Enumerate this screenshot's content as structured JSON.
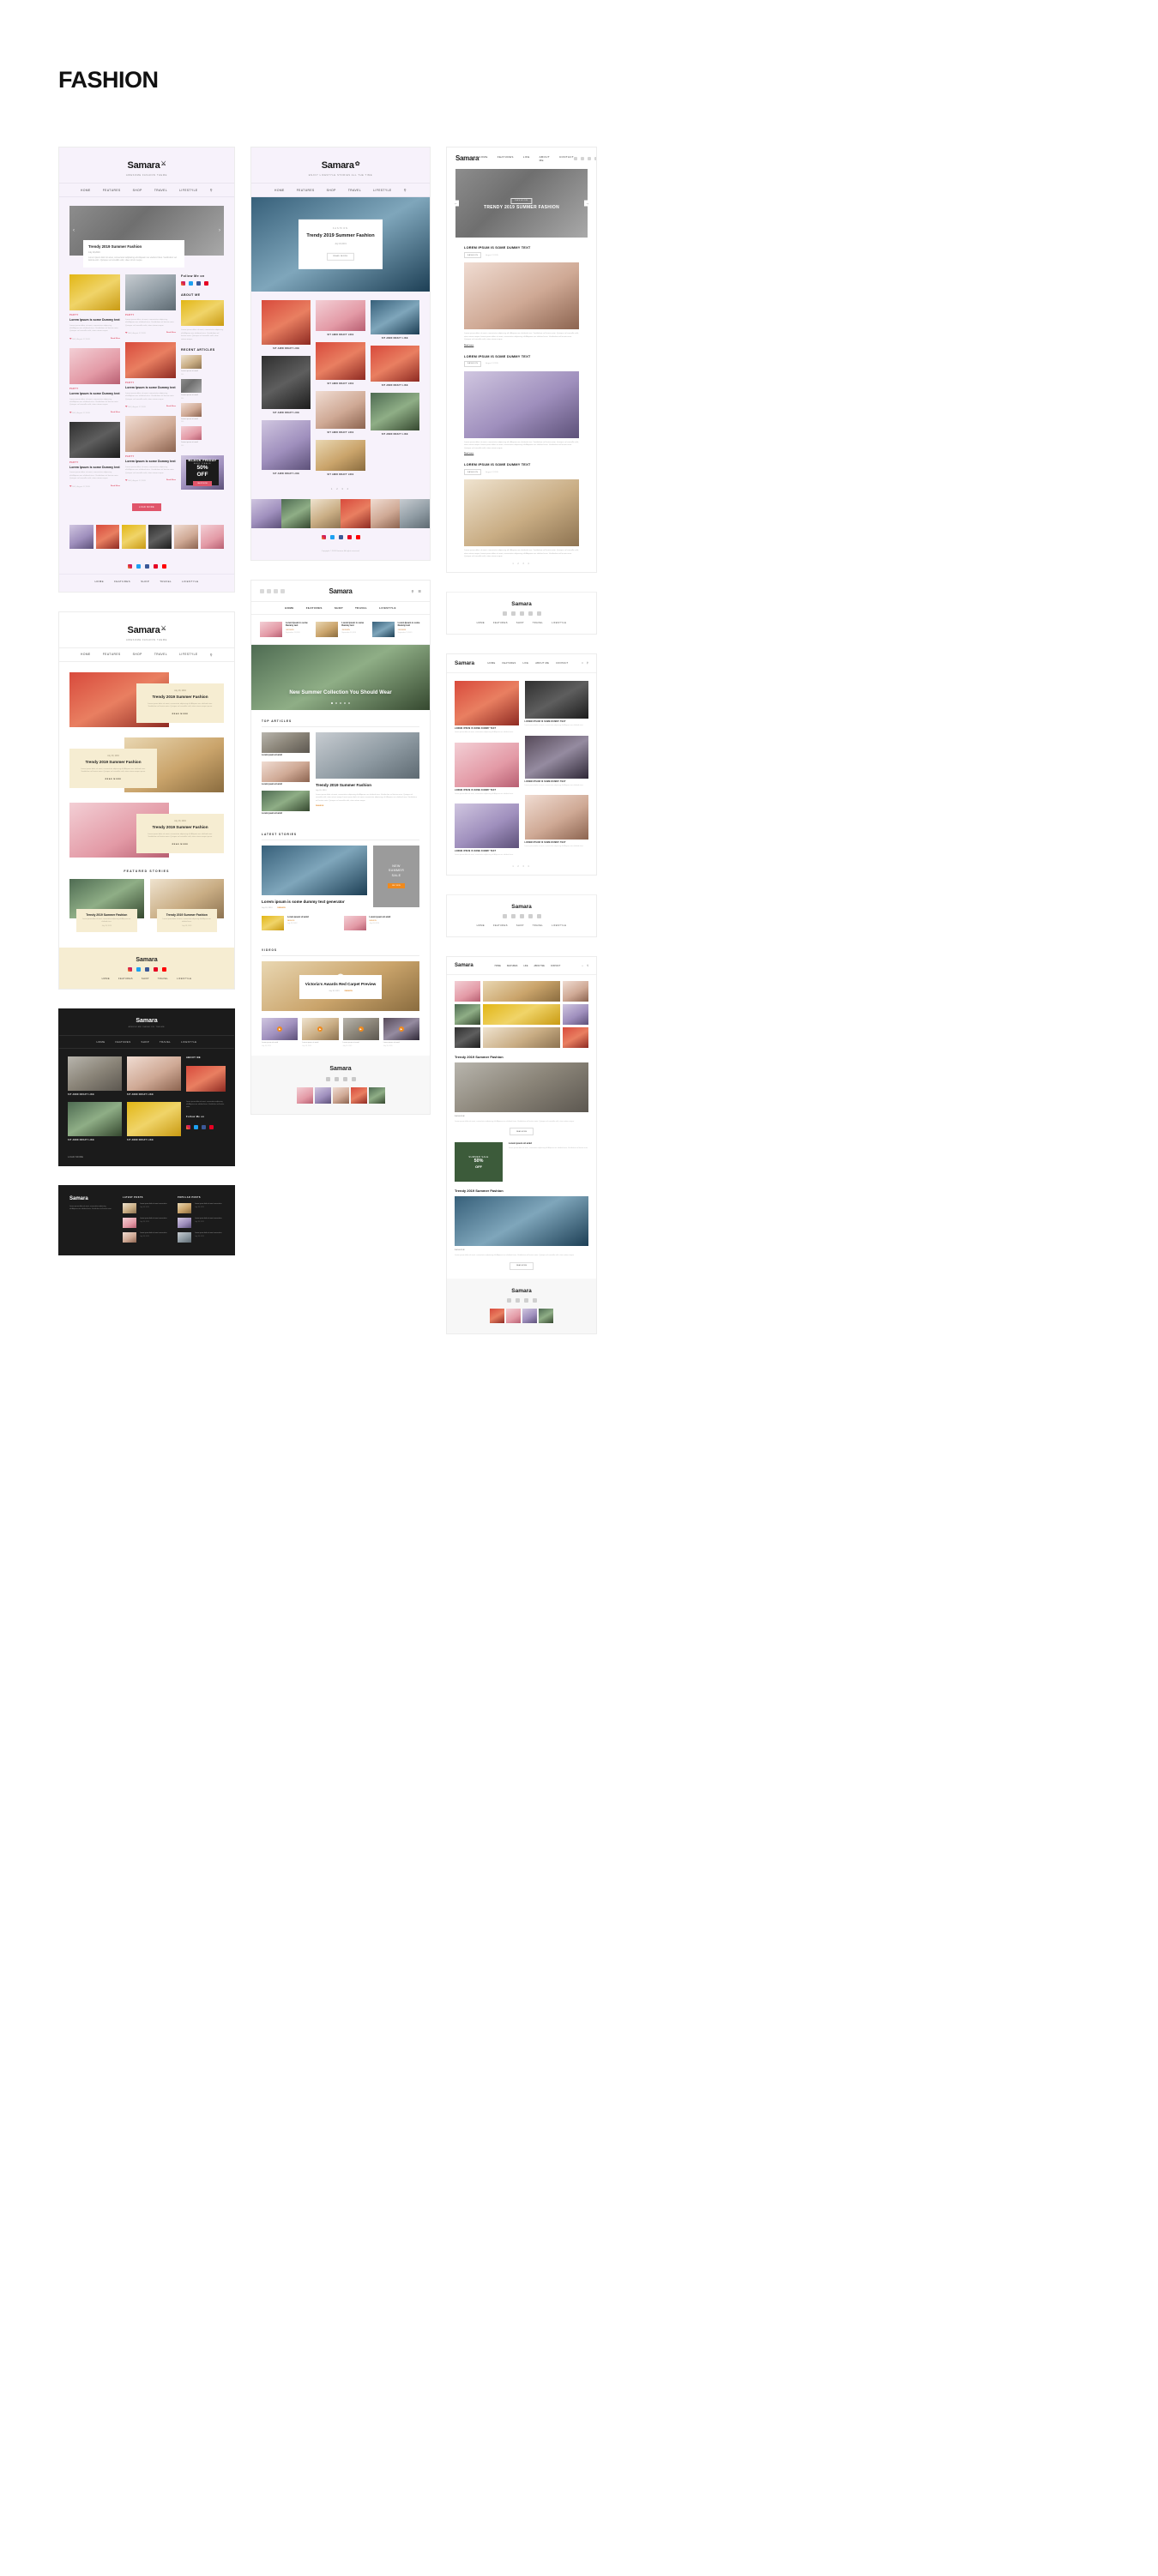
{
  "page": {
    "title": "FASHION"
  },
  "brand": {
    "name": "Samara",
    "tagline_1": "AWESOME FASHION THEME",
    "tagline_2": "ENJOY LIFESTYLE STORIES ALL THE TIME",
    "tagline_dark": "AWESOME FASHION THEME"
  },
  "nav": {
    "primary": [
      "HOME",
      "FEATURES",
      "SHOP",
      "TRAVEL",
      "LIFESTYLE"
    ],
    "magazine": [
      "HOME",
      "FEATURES",
      "LIFE",
      "ABOUT ME",
      "CONTACT"
    ],
    "gallery": [
      "HOME",
      "FEATURES",
      "LIFE",
      "ABOUT ME",
      "CONTACT"
    ],
    "search_icon": "search-icon",
    "menu_icon": "hamburger-icon"
  },
  "social": {
    "instagram": "instagram-icon",
    "twitter": "twitter-icon",
    "facebook": "facebook-icon",
    "pinterest": "pinterest-icon",
    "youtube": "youtube-icon"
  },
  "mock1": {
    "hero": {
      "title": "Trendy 2019 Summer Fashion",
      "date": "July 18,2019",
      "excerpt": "Lorem ipsum dolor sit amet, consectetur adipiscing elit.Aliquam nec eleifend risus. Vestibulum vel lacinia enim. Quisque vel convallis velit, vitae rutrum neque."
    },
    "arrow_prev": "chevron-left-icon",
    "arrow_next": "chevron-right-icon",
    "category": "PARTY",
    "card_title": "Lorem Ipsum is some Dummy text",
    "card_body": "Lorem ipsum dolor sit amet, consectetur adipiscing elit.Aliquam nec eleifend risus. Vestibulum vel lacinia enim. Quisque vel convallis velit, vitae rutrum neque.",
    "likes": "500",
    "date": "August 17,2019",
    "read_more": "Read More",
    "sidebar": {
      "follow_title": "Follow Me on",
      "about_title": "ABOUT ME",
      "about_text": "Lorem ipsum dolor sit amet, consectetur adipiscing elit.Aliquam nec eleifend risus. Vestibulum vel lacinia enim. Quisque vel convallis velit, vitae rutrum neque.",
      "recent_title": "RECENT ARTICLES",
      "recent_item": "Lorem ipsum sit amid",
      "recent_meta_likes": "500",
      "recent_meta_views": "500"
    },
    "promo": {
      "title": "BLACK FRIDAY",
      "subtitle": "BEST DEALS",
      "percent": "50%",
      "off": "OFF",
      "button": "SHOP NOW"
    },
    "load_more": "LOAD MORE"
  },
  "mock2": {
    "hero": {
      "category": "FASHION",
      "title": "Trendy 2019 Summer Fashion",
      "date": "July 18,2019",
      "button": "READ MORE"
    },
    "caption": "SIT AMID DRAFT LIKE",
    "pager": "1 2 3 4",
    "copyright": "Copyright © 2019 Samara. All rights reserved."
  },
  "mock3": {
    "hero": {
      "badge": "FASHION",
      "title": "TRENDY 2019 SUMMER FASHION"
    },
    "article_title": "LOREM IPSUM IS SOME DUMMY TEXT",
    "tag": "FASHION",
    "date": "August 17,2019",
    "body": "Lorem ipsum dolor sit amet, consectetur adipiscing elit. Aliquam nec eleifend risus. Vestibulum vel lacinia enim. Quisque vel convallis velit, vitae rutrum neque.Lorem ipsum dolor sit amet, consectetur adipiscing elit.Aliquam nec eleifend risus. Vestibulum vel lacinia enim. Quisque vel convallis velit, vitae rutrum neque.",
    "read_more": "Read more",
    "pager": "1 2 3 4"
  },
  "mock4": {
    "card": {
      "date": "July 18, 2019",
      "title": "Trendy 2019 Summer Fashion",
      "body": "Lorem ipsum dolor sit amet, consectetur adipiscing elit.Aliquam nec eleifend risus. Vestibulum vel lacinia enim. Quisque vel convallis velit, vitae rutrum neque ipsum.",
      "read_more": "READ MORE"
    },
    "featured_title": "FEATURED STORIES",
    "featured_card_title": "Trendy 2019 Summer Fashion",
    "featured_card_body": "Lorem ipsum dolor sit amet, consectetur adipiscing elit.Aliquam nec eleifend risus.",
    "featured_card_date": "July 18, 2019"
  },
  "mock5": {
    "strip_title": "Lorem Ipsum is some Dummy text",
    "strip_cat": "#MODERN",
    "strip_date": "September 21,2019",
    "hero_title": "New Summer Collection You Should Wear",
    "top_articles_title": "TOP ARTICLES",
    "top_item": "Lorem ipsum sit amid",
    "feature_title": "Trendy 2019 Summer Fashion",
    "feature_date": "July 18, 2019",
    "feature_body": "Lorem ipsum dolor sit amet, consectetur adipiscing elit.Aliquam nec eleifend risus. Vestibulum vel lacinia enim. Quisque vel convallis velit, vitae rutrum neque Lorem ipsum dolor sit amet, consectetur adipiscing elit. Aliquam nec eleifend risus. Vestibulum vel lacinia enim. Quisque vel convallis velit, vitae rutrum neque",
    "feature_cat": "FASHION",
    "latest_title": "LATEST STORIES",
    "latest_headline": "Lorem ipsum is some dummy text generator",
    "latest_date": "July 18, 2019",
    "latest_cat": "FASHION",
    "ad": {
      "line1": "NEW",
      "line2": "SUMMER",
      "line3": "SALE",
      "button": "BUY NOW"
    },
    "small_title": "Lorem ipsum sit amid",
    "videos_title": "VIDEOS",
    "video_title": "Victoria's Awards Red Carpet Preview",
    "video_date": "July 18, 2019",
    "video_cat": "FASHION",
    "video_item": "Lorem ipsum sit amid",
    "play_icon": "play-icon"
  },
  "mock6": {
    "card_title": "LOREM IPSUM IS SOME DUMMY TEXT",
    "card_body": "Lorem ipsum dolor sit amet, consectetur adipiscing elit.Aliquam nec eleifend risus.",
    "pager": "1 2 3 4"
  },
  "mock7": {
    "caption": "SIT AMID DRAFT LIKE",
    "about_title": "ABOUT ME",
    "about_text": "Lorem ipsum dolor sit amet, consectetur adipiscing elit.Aliquam nec eleifend risus. Vestibulum vel lacinia enim.",
    "follow_title": "Follow Me on",
    "load_more": "LOAD MORE"
  },
  "mock8": {
    "brand_text": "Lorem ipsum dolor sit amet, consectetur adipiscing elit.Aliquam nec eleifend risus. Vestibulum vel lacinia enim.",
    "latest_title": "LATEST POSTS",
    "popular_title": "POPULAR POSTS",
    "item_title": "Lorem ipsum dolor sit amet consectetur",
    "item_date": "July 18, 2019"
  },
  "mock9": {
    "feature_title": "Trendy 2019 Summer Fashion",
    "feature_body": "Lorem ipsum dolor sit amet, consectetur adipiscing elit.Aliquam nec eleifend risus. Vestibulum vel lacinia enim. Quisque vel convallis velit, vitae rutrum neque.",
    "feature_cat": "FASHION",
    "read_more": "READ MORE",
    "sale": {
      "title": "SUMMER SALE",
      "percent": "50%",
      "off": "OFF"
    },
    "sale_head": "Lorem ipsum sit amid",
    "sale_body": "Lorem ipsum dolor sit amet, consectetur adipiscing elit.Aliquam nec eleifend risus. Vestibulum vel lacinia enim."
  },
  "colors": {
    "accent_pink": "#e0556a",
    "accent_orange": "#f08a1d",
    "lavender_bg": "#f7f2fb",
    "cream": "#f6edd2",
    "dark": "#1b1b1b",
    "green": "#3c5b3a"
  }
}
